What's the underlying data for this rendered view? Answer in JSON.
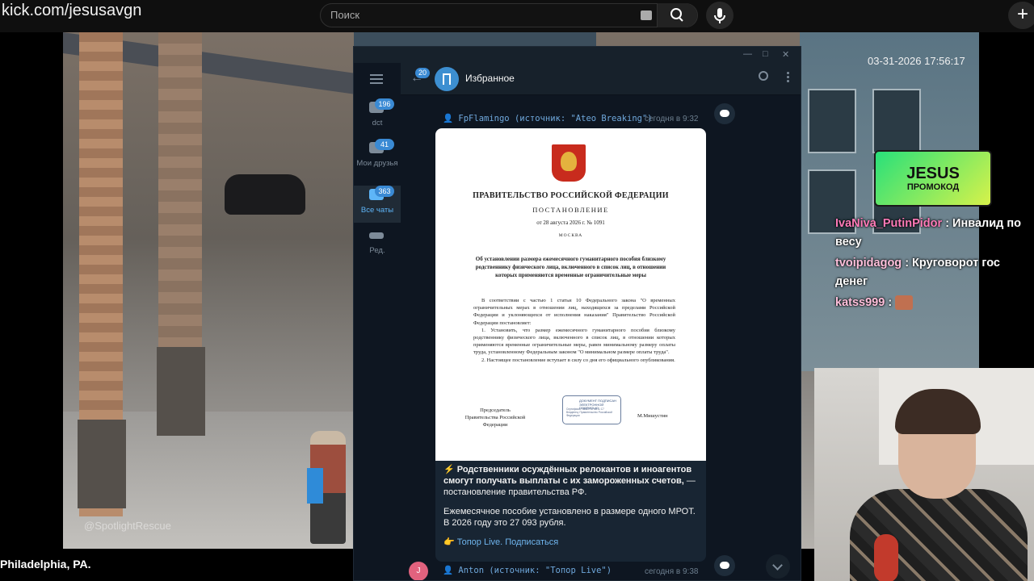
{
  "browser": {
    "url": "kick.com/jesusavgn",
    "search_placeholder": "Поиск",
    "add_label": "+"
  },
  "stream": {
    "timestamp": "03-31-2026 17:56:17",
    "watermark": "@SpotlightRescue",
    "location": "Philadelphia, PA.",
    "promo_title": "JESUS",
    "promo_subtitle": "ПРОМОКОД"
  },
  "chat": [
    {
      "nick": "IvaNiva_PutinPidor",
      "text": ": Инвалид по весу",
      "emote": false
    },
    {
      "nick": "tvoipidagog",
      "text": ": Круговорот гос денег",
      "emote": false
    },
    {
      "nick": "katss999",
      "text": ":",
      "emote": true
    }
  ],
  "telegram": {
    "window_controls": [
      "—",
      "□",
      "✕"
    ],
    "folders": [
      {
        "label": "dct",
        "badge": "196",
        "active": false
      },
      {
        "label": "Мои друзья",
        "badge": "41",
        "active": false
      },
      {
        "label": "Все чаты",
        "badge": "363",
        "active": true
      },
      {
        "label": "Ред.",
        "badge": "",
        "active": false
      }
    ],
    "header": {
      "back_badge": "20",
      "chat_name": "Избранное"
    },
    "post1": {
      "forwarded": "FpFlamingo (источник: \"Ateo Breaking\")",
      "time": "сегодня в 9:32"
    },
    "document": {
      "government": "ПРАВИТЕЛЬСТВО РОССИЙСКОЙ ФЕДЕРАЦИИ",
      "type": "ПОСТАНОВЛЕНИЕ",
      "date": "от 28 августа 2026 г. № 1091",
      "city": "МОСКВА",
      "subject": "Об установлении размера ежемесячного гуманитарного пособия близкому родственнику физического лица, включенного в список лиц, в отношении которых применяются временные ограничительные меры",
      "body_1": "В соответствии с частью 1 статьи 10 Федерального закона \"О временных ограничительных мерах в отношении лиц, находящихся за пределами Российской Федерации и уклоняющихся от исполнения наказания\" Правительство Российской Федерации постановляет:",
      "body_2": "1. Установить, что размер ежемесячного гуманитарного пособия близкому родственнику физического лица, включенного в список лиц, в отношении которых применяются временные ограничительные меры, равен минимальному размеру оплаты труда, установленному Федеральным законом \"О минимальном размере оплаты труда\".",
      "body_3": "2. Настоящее постановление вступает в силу со дня его официального опубликования.",
      "sign_left": "Председатель Правительства Российской Федерации",
      "stamp_title": "ДОКУМЕНТ ПОДПИСАН ЭЛЕКТРОННОЙ ПОДПИСЬЮ",
      "stamp_details": "Сертификат: 00 ED 92 4A 11 C7 Владелец: Правительство Российской Федерации",
      "sign_right": "М.Мишустин"
    },
    "message": {
      "headline": "⚡ Родственники осуждённых релокантов и иноагентов смогут получать выплаты с их замороженных счетов,",
      "headline_rest": " — постановление правительства РФ.",
      "body": "Ежемесячное пособие установлено в размере одного МРОТ. В 2026 году это 27 093 рубля.",
      "link": "👉 Топор Live. Подписаться"
    },
    "post2": {
      "avatar_letter": "J",
      "forwarded": "Anton (источник: \"Топор Live\")",
      "time": "сегодня в 9:38"
    }
  },
  "colors": {
    "tg_bg": "#0e1621",
    "tg_accent": "#5eb5f7",
    "promo_green": "#28e07a",
    "chat_nick": "#ff7ab8"
  }
}
